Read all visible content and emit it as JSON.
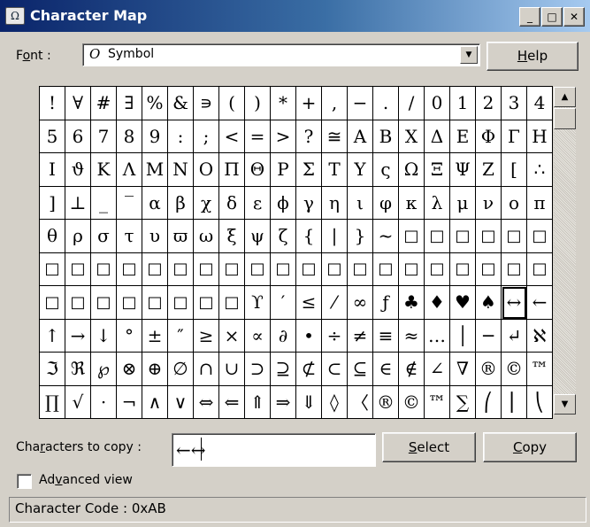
{
  "window": {
    "title": "Character Map",
    "icon": "charmap-app-icon"
  },
  "titlebar_buttons": {
    "minimize": "_",
    "maximize": "□",
    "close": "✕"
  },
  "font": {
    "label_prefix": "F",
    "label_underlined": "o",
    "label_suffix": "nt :",
    "selected_icon": "O",
    "selected": "Symbol"
  },
  "help_button": {
    "underlined": "H",
    "rest": "elp"
  },
  "grid_rows": [
    [
      "!",
      "∀",
      "#",
      "∃",
      "%",
      "&",
      "∍",
      "(",
      ")",
      "*",
      "+",
      ",",
      "−",
      ".",
      "/",
      "0",
      "1",
      "2",
      "3",
      "4"
    ],
    [
      "5",
      "6",
      "7",
      "8",
      "9",
      ":",
      ";",
      "<",
      "=",
      ">",
      "?",
      "≅",
      "Α",
      "Β",
      "Χ",
      "Δ",
      "Ε",
      "Φ",
      "Γ",
      "Η"
    ],
    [
      "Ι",
      "ϑ",
      "Κ",
      "Λ",
      "Μ",
      "Ν",
      "Ο",
      "Π",
      "Θ",
      "Ρ",
      "Σ",
      "Τ",
      "Υ",
      "ς",
      "Ω",
      "Ξ",
      "Ψ",
      "Ζ",
      "[",
      "∴"
    ],
    [
      "]",
      "⊥",
      "_",
      "‾",
      "α",
      "β",
      "χ",
      "δ",
      "ε",
      "ϕ",
      "γ",
      "η",
      "ι",
      "φ",
      "κ",
      "λ",
      "μ",
      "ν",
      "ο",
      "π"
    ],
    [
      "θ",
      "ρ",
      "σ",
      "τ",
      "υ",
      "ϖ",
      "ω",
      "ξ",
      "ψ",
      "ζ",
      "{",
      "|",
      "}",
      "~",
      "□",
      "□",
      "□",
      "□",
      "□",
      "□"
    ],
    [
      "□",
      "□",
      "□",
      "□",
      "□",
      "□",
      "□",
      "□",
      "□",
      "□",
      "□",
      "□",
      "□",
      "□",
      "□",
      "□",
      "□",
      "□",
      "□",
      "□"
    ],
    [
      "□",
      "□",
      "□",
      "□",
      "□",
      "□",
      "□",
      "□",
      "ϒ",
      "′",
      "≤",
      "⁄",
      "∞",
      "ƒ",
      "♣",
      "♦",
      "♥",
      "♠",
      "↔",
      "←"
    ],
    [
      "↑",
      "→",
      "↓",
      "°",
      "±",
      "″",
      "≥",
      "×",
      "∝",
      "∂",
      "•",
      "÷",
      "≠",
      "≡",
      "≈",
      "…",
      "│",
      "─",
      "↵",
      "ℵ"
    ],
    [
      "ℑ",
      "ℜ",
      "℘",
      "⊗",
      "⊕",
      "∅",
      "∩",
      "∪",
      "⊃",
      "⊇",
      "⊄",
      "⊂",
      "⊆",
      "∈",
      "∉",
      "∠",
      "∇",
      "®",
      "©",
      "™"
    ],
    [
      "∏",
      "√",
      "⋅",
      "¬",
      "∧",
      "∨",
      "⇔",
      "⇐",
      "⇑",
      "⇒",
      "⇓",
      "◊",
      "〈",
      "®",
      "©",
      "™",
      "∑",
      "⎛",
      "⎜",
      "⎝"
    ]
  ],
  "selected_char": {
    "row": 6,
    "col": 18
  },
  "copy": {
    "label_prefix": "Cha",
    "label_underlined": "r",
    "label_suffix": "acters to copy :",
    "value": "←↔"
  },
  "select_button": {
    "underlined": "S",
    "rest": "elect"
  },
  "copy_button": {
    "underlined": "C",
    "rest": "opy"
  },
  "advanced": {
    "label_prefix": "Ad",
    "label_underlined": "v",
    "label_suffix": "anced view",
    "checked": false
  },
  "status": {
    "text": "Character Code : 0xAB"
  },
  "scrollbar": {
    "up_glyph": "▲",
    "down_glyph": "▼"
  }
}
